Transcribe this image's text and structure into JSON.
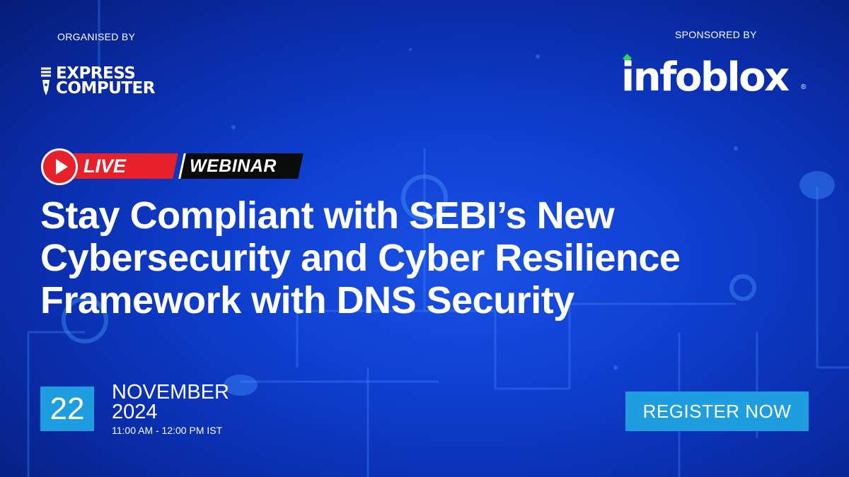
{
  "organiser": {
    "label": "ORGANISED BY",
    "logo_line1": "EXPRESS",
    "logo_line2": "COMPUTER"
  },
  "sponsor": {
    "label": "SPONSORED BY",
    "logo_text": "infoblox",
    "logo_mark": "®",
    "logo_accent_color": "#2bd45f"
  },
  "badge": {
    "live": "LIVE",
    "webinar": "WEBINAR",
    "icon": "play-icon",
    "live_color": "#e8202a",
    "webinar_color": "#0b0b0b"
  },
  "headline": {
    "lines": [
      "Stay Compliant with SEBI’s New",
      "Cybersecurity and Cyber Resilience",
      "Framework with DNS Security"
    ]
  },
  "event": {
    "day": "22",
    "month": "NOVEMBER",
    "year": "2024",
    "time": "11:00 AM - 12:00 PM IST"
  },
  "cta": {
    "label": "REGISTER NOW",
    "color": "#1e9de0"
  },
  "theme": {
    "background": "#0f3fd0",
    "text": "#ffffff"
  }
}
